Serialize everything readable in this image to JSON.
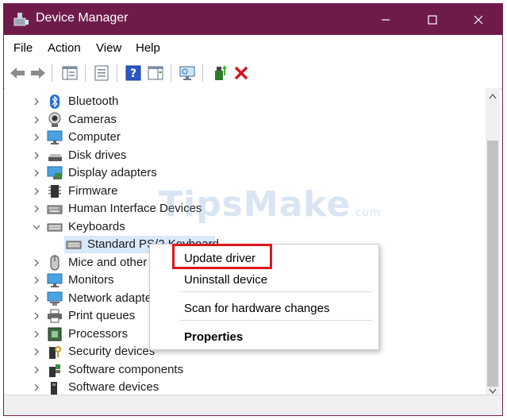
{
  "window": {
    "title": "Device Manager",
    "accent": "#6e1b4a"
  },
  "menu": {
    "file": "File",
    "action": "Action",
    "view": "View",
    "help": "Help"
  },
  "toolbar": {
    "icons": [
      "back-arrow-icon",
      "forward-arrow-icon",
      "show-hide-tree-icon",
      "properties-icon",
      "help-icon",
      "action-pane-icon",
      "scan-monitor-icon",
      "update-driver-icon",
      "uninstall-x-icon"
    ]
  },
  "tree": {
    "items": [
      {
        "label": "Bluetooth",
        "expanded": false
      },
      {
        "label": "Cameras",
        "expanded": false
      },
      {
        "label": "Computer",
        "expanded": false
      },
      {
        "label": "Disk drives",
        "expanded": false
      },
      {
        "label": "Display adapters",
        "expanded": false
      },
      {
        "label": "Firmware",
        "expanded": false
      },
      {
        "label": "Human Interface Devices",
        "expanded": false
      },
      {
        "label": "Keyboards",
        "expanded": true
      },
      {
        "label": "Standard PS/2 Keyboard",
        "child": true,
        "selected": true
      },
      {
        "label": "Mice and other",
        "expanded": false
      },
      {
        "label": "Monitors",
        "expanded": false
      },
      {
        "label": "Network adapte",
        "expanded": false
      },
      {
        "label": "Print queues",
        "expanded": false
      },
      {
        "label": "Processors",
        "expanded": false
      },
      {
        "label": "Security devices",
        "expanded": false
      },
      {
        "label": "Software components",
        "expanded": false
      },
      {
        "label": "Software devices",
        "expanded": false
      }
    ]
  },
  "context_menu": {
    "update_driver": "Update driver",
    "uninstall_device": "Uninstall device",
    "scan_changes": "Scan for hardware changes",
    "properties": "Properties",
    "highlight_color": "#e0161c"
  },
  "watermark": {
    "text": "TipsMake",
    "suffix": ".com"
  }
}
